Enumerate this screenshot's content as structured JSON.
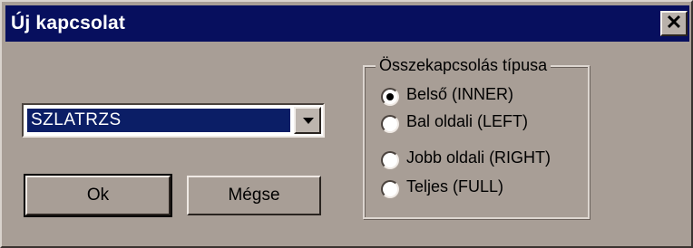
{
  "window": {
    "title": "Új kapcsolat",
    "close_symbol": "✕"
  },
  "table_select": {
    "value": "SZLATRZS"
  },
  "buttons": {
    "ok_label": "Ok",
    "cancel_label": "Mégse"
  },
  "join_type": {
    "legend": "Összekapcsolás típusa",
    "selected": "inner",
    "options": [
      {
        "id": "inner",
        "label": "Belső (INNER)"
      },
      {
        "id": "left",
        "label": "Bal oldali (LEFT)"
      },
      {
        "id": "right",
        "label": "Jobb oldali (RIGHT)"
      },
      {
        "id": "full",
        "label": "Teljes (FULL)"
      }
    ]
  },
  "colors": {
    "titlebar": "#070f5e",
    "dialog_face": "#a89e96",
    "selection": "#0b1e66"
  }
}
